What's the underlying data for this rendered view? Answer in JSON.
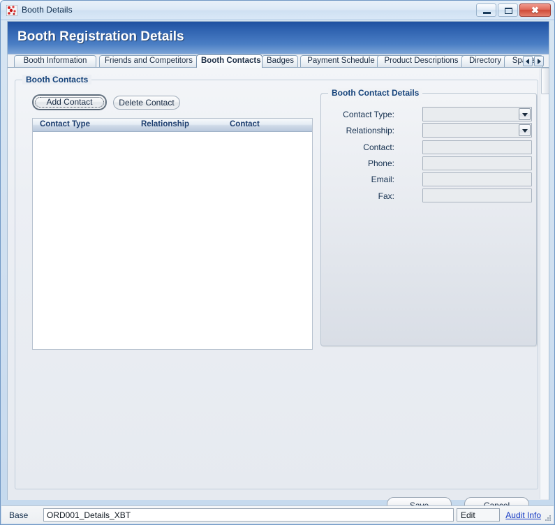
{
  "window": {
    "title": "Booth Details",
    "icon": "app-dots-icon",
    "controls": {
      "minimize": "minimize-icon",
      "maximize": "maximize-icon",
      "close": "✖"
    }
  },
  "header": {
    "title": "Booth Registration Details",
    "gradient_top": "#1e50a0",
    "gradient_bottom": "#7ba3d6"
  },
  "tabs": {
    "items": [
      {
        "label": "Booth Information",
        "active": false
      },
      {
        "label": "Friends and Competitors",
        "active": false
      },
      {
        "label": "Booth Contacts",
        "active": true
      },
      {
        "label": "Badges",
        "active": false
      },
      {
        "label": "Payment Schedule",
        "active": false
      },
      {
        "label": "Product Descriptions",
        "active": false
      },
      {
        "label": "Directory",
        "active": false
      },
      {
        "label": "Space",
        "active": false
      }
    ],
    "scroll_prev": "chevron-left-icon",
    "scroll_next": "chevron-right-icon"
  },
  "contacts_group": {
    "title": "Booth Contacts",
    "add_button": "Add Contact",
    "delete_button": "Delete Contact",
    "grid": {
      "columns": [
        "Contact Type",
        "Relationship",
        "Contact"
      ],
      "rows": []
    }
  },
  "details_group": {
    "title": "Booth Contact Details",
    "fields": [
      {
        "label": "Contact Type:",
        "type": "combo",
        "value": ""
      },
      {
        "label": "Relationship:",
        "type": "combo",
        "value": ""
      },
      {
        "label": "Contact:",
        "type": "text",
        "value": ""
      },
      {
        "label": "Phone:",
        "type": "text",
        "value": ""
      },
      {
        "label": "Email:",
        "type": "text",
        "value": ""
      },
      {
        "label": "Fax:",
        "type": "text",
        "value": ""
      }
    ]
  },
  "actions": {
    "save": "Save",
    "cancel": "Cancel"
  },
  "statusbar": {
    "label": "Base",
    "value": "ORD001_Details_XBT",
    "mode": "Edit",
    "audit_link": "Audit Info"
  }
}
